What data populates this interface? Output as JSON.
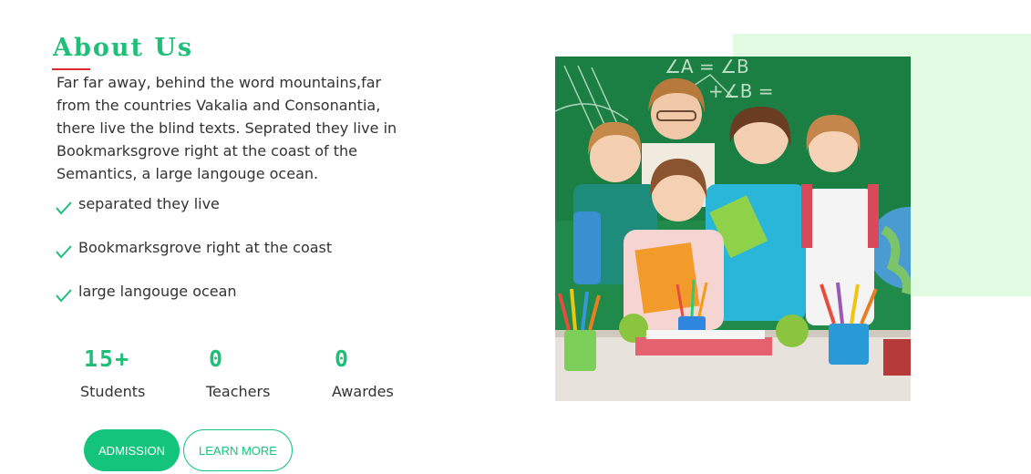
{
  "about": {
    "title": "About Us",
    "paragraph": "Far far away, behind the word mountains,far from the countries Vakalia and Consonantia, there live the blind texts. Seprated they live in Bookmarksgrove right at the coast of the Semantics, a large langouge ocean.",
    "checklist": [
      "separated they live",
      "Bookmarksgrove right at the coast",
      "large langouge ocean"
    ]
  },
  "stats": [
    {
      "value": "15+",
      "label": "Students"
    },
    {
      "value": "0",
      "label": "Teachers"
    },
    {
      "value": "0",
      "label": "Awardes"
    }
  ],
  "buttons": {
    "admission": "ADMISSION",
    "learn_more": "LEARN MORE"
  },
  "photo": {
    "chalkboard_text_top": "∠A = ∠B",
    "chalkboard_text_mid": "+∠B ="
  },
  "colors": {
    "accent": "#1fbf7a",
    "button_green": "#14c47c",
    "underline_red": "#d92b2b",
    "panel_mint": "#e0fbe2",
    "chalkboard": "#1f8a4a"
  },
  "icons": {
    "check": "check-icon"
  }
}
